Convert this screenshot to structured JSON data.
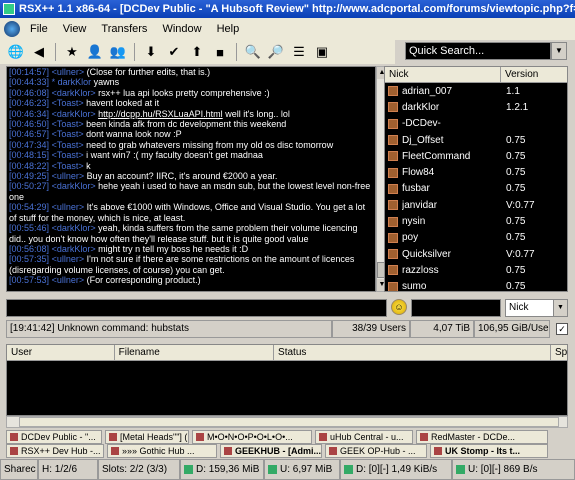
{
  "window": {
    "title": "RSX++ 1.1 x86-64 - [DCDev Public - \"A Hubsoft Review\" http://www.adcportal.com/forums/viewtopic.php?f=108t=560 ("
  },
  "menu": [
    "File",
    "View",
    "Transfers",
    "Window",
    "Help"
  ],
  "toolbar": {
    "icons": [
      "globe-icon",
      "back-icon",
      "star-icon",
      "users-icon",
      "users2-icon",
      "dl-icon",
      "check-icon",
      "up-icon",
      "stop-icon",
      "search-icon",
      "search2-icon",
      "list-icon",
      "monitor-icon"
    ]
  },
  "quick_search": {
    "placeholder": "Quick Search..."
  },
  "chat": [
    {
      "ts": "[00:14:57]",
      "nick": "<ullner>",
      "text": " (Close for further edits, that is.)"
    },
    {
      "ts": "[00:44:33]",
      "nick": "* darkKlor",
      "text": " yawns"
    },
    {
      "ts": "[00:46:08]",
      "nick": "<darkKlor>",
      "text": " rsx++ lua api looks pretty comprehensive :)"
    },
    {
      "ts": "[00:46:23]",
      "nick": "<Toast>",
      "text": " havent looked at it"
    },
    {
      "ts": "[00:46:34]",
      "nick": "<darkKlor>",
      "text": " ",
      "link": "http://dcpp.hu/RSXLuaAPI.html",
      "tail": " well it's long.. lol"
    },
    {
      "ts": "[00:46:50]",
      "nick": "<Toast>",
      "text": " been kinda afk from dc development this weekend"
    },
    {
      "ts": "[00:46:57]",
      "nick": "<Toast>",
      "text": " dont wanna look now :P"
    },
    {
      "ts": "[00:47:34]",
      "nick": "<Toast>",
      "text": " need to grab whatevers missing from my old os disc tomorrow"
    },
    {
      "ts": "[00:48:15]",
      "nick": "<Toast>",
      "text": " i want win7 :( my faculty doesn't get madnaa"
    },
    {
      "ts": "[00:48:22]",
      "nick": "<Toast>",
      "text": " k"
    },
    {
      "ts": "[00:49:25]",
      "nick": "<ullner>",
      "text": " Buy an account? IIRC, it's around €2000 a year."
    },
    {
      "ts": "[00:50:27]",
      "nick": "<darkKlor>",
      "text": " hehe yeah i used to have an msdn sub, but the lowest level non-free one"
    },
    {
      "ts": "[00:54:29]",
      "nick": "<ullner>",
      "text": " It's above €1000 with Windows, Office and Visual Studio. You get a lot of stuff for the money, which is nice, at least."
    },
    {
      "ts": "[00:55:46]",
      "nick": "<darkKlor>",
      "text": " yeah, kinda suffers from the same problem their volume licencing did.. you don't know how often they'll release stuff. but it is quite good value"
    },
    {
      "ts": "[00:56:08]",
      "nick": "<darkKlor>",
      "text": " might try n tell my boss he needs it :D"
    },
    {
      "ts": "[00:57:35]",
      "nick": "<ullner>",
      "text": " I'm not sure if there are some restrictions on the amount of licences (disregarding volume licenses, of course) you can get."
    },
    {
      "ts": "[00:57:53]",
      "nick": "<ullner>",
      "text": " (For corresponding product.)"
    }
  ],
  "userlist": {
    "headers": [
      "Nick",
      "Version"
    ],
    "users": [
      {
        "nick": "adrian_007",
        "version": "1.1"
      },
      {
        "nick": "darkKlor",
        "version": "1.2.1"
      },
      {
        "nick": "-DCDev-",
        "version": ""
      },
      {
        "nick": "Dj_Offset",
        "version": "0.75"
      },
      {
        "nick": "FleetCommand",
        "version": "0.75"
      },
      {
        "nick": "Flow84",
        "version": "0.75"
      },
      {
        "nick": "fusbar",
        "version": "0.75"
      },
      {
        "nick": "janvidar",
        "version": "V:0.77"
      },
      {
        "nick": "nysin",
        "version": "0.75"
      },
      {
        "nick": "poy",
        "version": "0.75"
      },
      {
        "nick": "Quicksilver",
        "version": "V:0.77"
      },
      {
        "nick": "razzloss",
        "version": "0.75"
      },
      {
        "nick": "sumo",
        "version": "0.75"
      }
    ]
  },
  "nick_select": "Nick",
  "status": {
    "message": "[19:41:42] Unknown command: hubstats",
    "users": "38/39 Users",
    "share": "4,07 TiB",
    "per_user": "106,95 GiB/User"
  },
  "transfers": {
    "headers": [
      "User",
      "Filename",
      "Status",
      "Sp"
    ]
  },
  "tabs_row1": [
    "DCDev Public - \"...",
    "[Metal Heads\"\"] (...",
    "M•O•N•O•P•O•L•O•...",
    "uHub Central - u...",
    "RedMaster - DCDe..."
  ],
  "tabs_row2": [
    "RSX++ Dev Hub -...",
    "»»» Gothic Hub ...",
    "GEEKHUB - [Admi...",
    "GEEK OP-Hub - ...",
    "UK Stomp - Its t..."
  ],
  "statusbar": [
    "Sharec",
    "H: 1/2/6",
    "Slots: 2/2 (3/3)",
    "D: 159,36 MiB",
    "U: 6,97 MiB",
    "D: [0][-] 1,49 KiB/s",
    "U: [0][-] 869 B/s"
  ]
}
